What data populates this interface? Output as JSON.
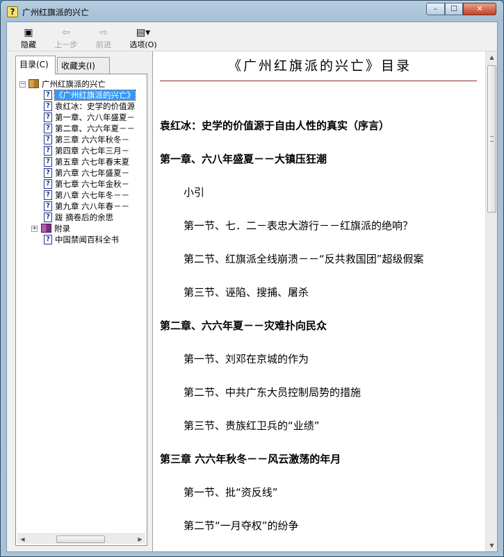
{
  "window": {
    "title": "广州红旗派的兴亡",
    "app_icon": "help-question-icon",
    "minimize": "–",
    "maximize": "☐",
    "close": "✕"
  },
  "toolbar": {
    "hide_label": "隐藏",
    "back_label": "上一步",
    "forward_label": "前进",
    "options_label": "选项(O)",
    "hide_icon": "hide-pane-icon",
    "back_icon": "arrow-left-icon",
    "forward_icon": "arrow-right-icon",
    "options_icon": "options-icon"
  },
  "tabs": {
    "contents": "目录(C)",
    "favorites": "收藏夹(I)"
  },
  "tree": {
    "root": "广州红旗派的兴亡",
    "items": [
      "《广州红旗派的兴亡》",
      "袁红冰：史学的价值源",
      "第一章、六八年盛夏－",
      "第二章、六六年夏－－",
      "第三章 六六年秋冬－",
      "第四章 六七年三月－",
      "第五章 六七年春末夏",
      "第六章 六七年盛夏－",
      "第七章 六七年金秋－",
      "第八章 六七年冬－－",
      "第九章 六八年春－－",
      "跋 摘卷后的余思"
    ],
    "appendix": "附录",
    "extra": "中国禁闻百科全书"
  },
  "document": {
    "title": "《广州红旗派的兴亡》目录",
    "entries": [
      {
        "kind": "chapter",
        "text": "袁红冰：史学的价值源于自由人性的真实（序言）"
      },
      {
        "kind": "chapter",
        "text": "第一章、六八年盛夏－－大镇压狂潮"
      },
      {
        "kind": "section",
        "text": "小引"
      },
      {
        "kind": "section",
        "text": "第一节、七．二－表忠大游行－－红旗派的绝响？"
      },
      {
        "kind": "section",
        "text": "第二节、红旗派全线崩溃－－“反共救国团”超级假案"
      },
      {
        "kind": "section",
        "text": "第三节、诬陷、搜捕、屠杀"
      },
      {
        "kind": "chapter",
        "text": "第二章、六六年夏－－灾难扑向民众"
      },
      {
        "kind": "section",
        "text": "第一节、刘邓在京城的作为"
      },
      {
        "kind": "section",
        "text": "第二节、中共广东大员控制局势的措施"
      },
      {
        "kind": "section",
        "text": "第三节、贵族红卫兵的“业绩”"
      },
      {
        "kind": "chapter",
        "text": "第三章 六六年秋冬－－风云激荡的年月"
      },
      {
        "kind": "section",
        "text": "第一节、批“资反线”"
      },
      {
        "kind": "section",
        "text": "第二节“一月夺权”的纷争"
      }
    ]
  }
}
